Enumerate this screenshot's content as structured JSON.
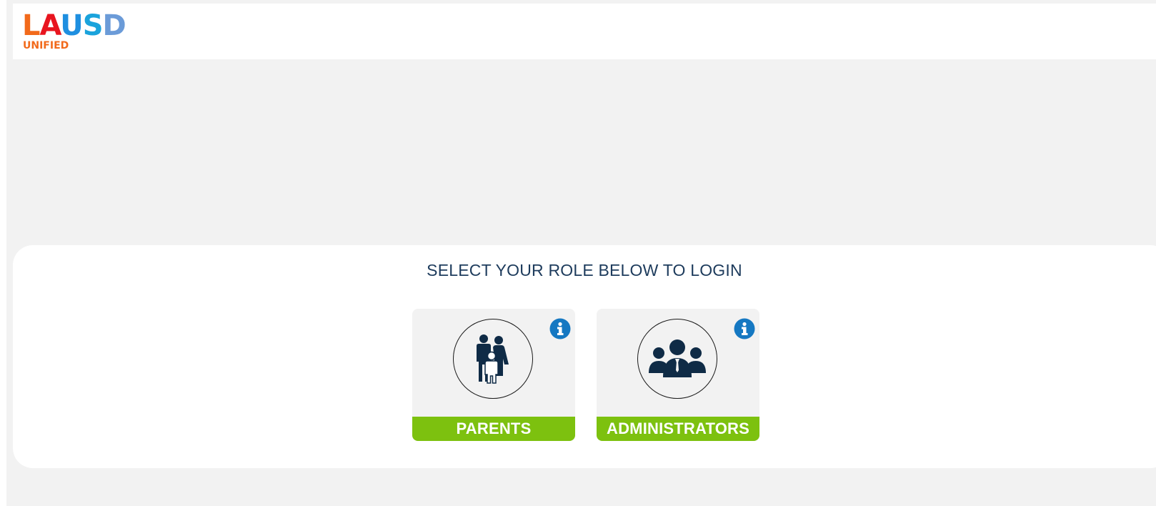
{
  "header": {
    "logo": {
      "letters": [
        "L",
        "A",
        "U",
        "S",
        "D"
      ],
      "letter_colors": [
        "#f26a1b",
        "#e8151f",
        "#1e8fe0",
        "#1aa3dc",
        "#6b9bd8"
      ],
      "subtitle": "UNIFIED",
      "subtitle_color": "#f26a1b"
    }
  },
  "login": {
    "title": "SELECT YOUR ROLE BELOW TO LOGIN",
    "roles": [
      {
        "label": "PARENTS",
        "icon": "family-icon",
        "info_icon": "info-icon"
      },
      {
        "label": "ADMINISTRATORS",
        "icon": "group-icon",
        "info_icon": "info-icon"
      }
    ]
  },
  "colors": {
    "background": "#f2f2f2",
    "title_text": "#1d3b5c",
    "role_label_bg": "#7dc10f",
    "info_blue": "#1578c2",
    "icon_navy": "#0f2b46"
  }
}
